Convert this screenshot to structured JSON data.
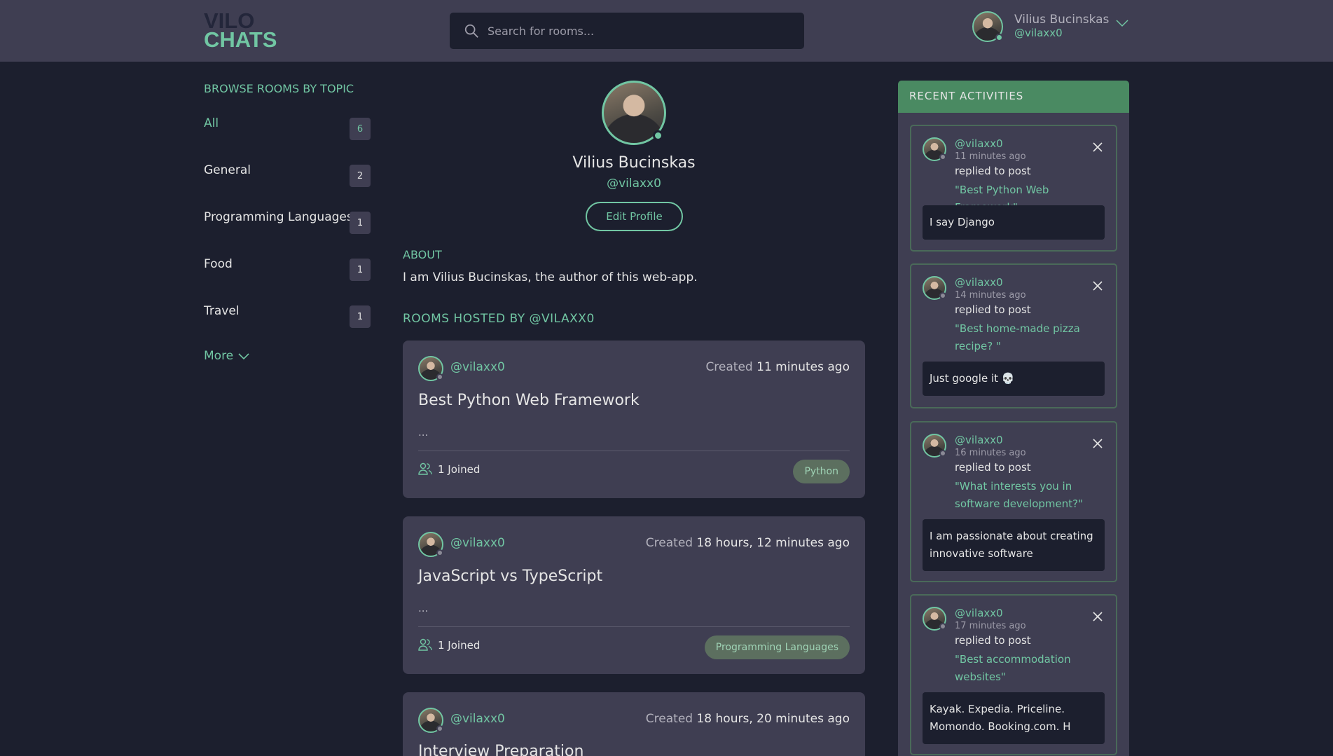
{
  "brand": {
    "line1": "VILO",
    "line2": "CHATS"
  },
  "search": {
    "placeholder": "Search for rooms..."
  },
  "user": {
    "name": "Vilius Bucinskas",
    "handle": "@vilaxx0"
  },
  "topics": {
    "title": "BROWSE ROOMS BY TOPIC",
    "items": [
      {
        "label": "All",
        "count": "6"
      },
      {
        "label": "General",
        "count": "2"
      },
      {
        "label": "Programming Languages",
        "count": "1"
      },
      {
        "label": "Food",
        "count": "1"
      },
      {
        "label": "Travel",
        "count": "1"
      }
    ],
    "more_label": "More"
  },
  "profile": {
    "name": "Vilius Bucinskas",
    "handle": "@vilaxx0",
    "edit_label": "Edit Profile",
    "about_title": "ABOUT",
    "about_text": "I am Vilius Bucinskas, the author of this web-app.",
    "rooms_title": "ROOMS HOSTED BY @VILAXX0"
  },
  "rooms": [
    {
      "host": "@vilaxx0",
      "created_prefix": "Created",
      "created_time": "11 minutes ago",
      "title": "Best Python Web Framework",
      "desc": "...",
      "joined": "1 Joined",
      "tag": "Python"
    },
    {
      "host": "@vilaxx0",
      "created_prefix": "Created",
      "created_time": "18 hours, 12 minutes ago",
      "title": "JavaScript vs TypeScript",
      "desc": "...",
      "joined": "1 Joined",
      "tag": "Programming Languages"
    },
    {
      "host": "@vilaxx0",
      "created_prefix": "Created",
      "created_time": "18 hours, 20 minutes ago",
      "title": "Interview Preparation",
      "desc": "",
      "joined": "",
      "tag": ""
    }
  ],
  "activities": {
    "title": "RECENT ACTIVITIES",
    "items": [
      {
        "handle": "@vilaxx0",
        "time": "11 minutes ago",
        "action": "replied to post",
        "post": "\"Best Python Web Framework\"",
        "message": "I say Django"
      },
      {
        "handle": "@vilaxx0",
        "time": "14 minutes ago",
        "action": "replied to post",
        "post": "\"Best home-made pizza recipe? \"",
        "message": "Just google it 💀"
      },
      {
        "handle": "@vilaxx0",
        "time": "16 minutes ago",
        "action": "replied to post",
        "post": "\"What interests you in software development?\"",
        "message": "I am passionate about creating innovative software"
      },
      {
        "handle": "@vilaxx0",
        "time": "17 minutes ago",
        "action": "replied to post",
        "post": "\"Best accommodation websites\"",
        "message": "Kayak. Expedia. Priceline. Momondo. Booking.com. H"
      }
    ]
  },
  "icons": {
    "search": "search-icon",
    "chevron": "chevron-down-icon",
    "close": "close-icon",
    "users": "users-icon"
  },
  "colors": {
    "accent": "#71c6a3",
    "background": "#1c1f2e",
    "surface": "#3f3e52",
    "activity_header": "#4a8a62"
  }
}
